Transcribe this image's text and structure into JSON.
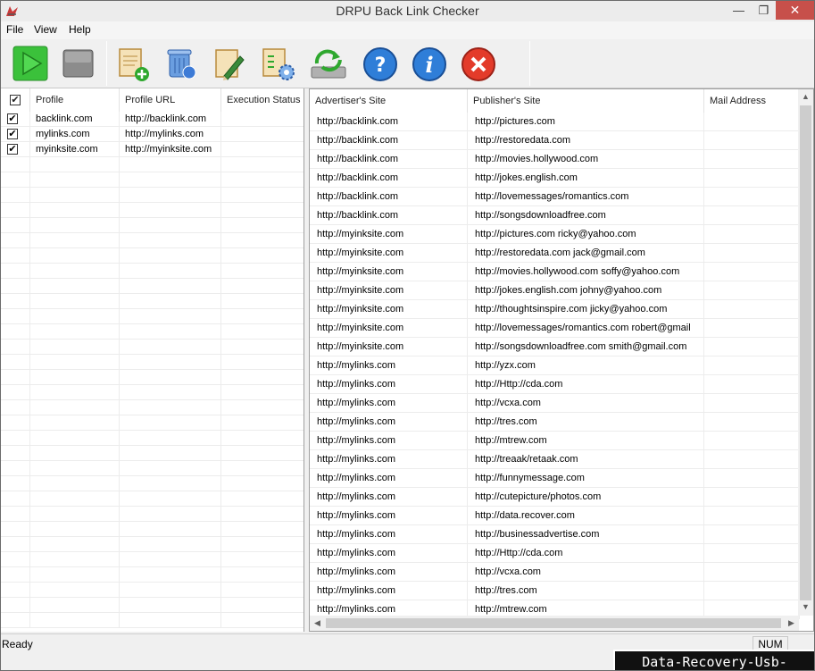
{
  "window": {
    "title": "DRPU Back Link Checker",
    "min_glyph": "—",
    "max_glyph": "❐",
    "close_glyph": "✕"
  },
  "menu": [
    "File",
    "View",
    "Help"
  ],
  "toolbar": {
    "buttons": [
      {
        "name": "start-icon",
        "color": "#3bc13b"
      },
      {
        "name": "stop-icon",
        "color": "#8c8c8c"
      },
      {
        "name": "add-profile-icon",
        "color": "#2fa82f"
      },
      {
        "name": "delete-profile-icon",
        "color": "#3d7bd6"
      },
      {
        "name": "edit-profile-icon",
        "color": "#3a8a3a"
      },
      {
        "name": "settings-icon",
        "color": "#3d7bd6"
      },
      {
        "name": "refresh-icon",
        "color": "#2fa82f"
      },
      {
        "name": "help-icon",
        "color": "#2f7ed8"
      },
      {
        "name": "about-icon",
        "color": "#2f7ed8"
      },
      {
        "name": "exit-icon",
        "color": "#e33b2a"
      }
    ]
  },
  "profiles": {
    "columns": [
      "✔",
      "Profile",
      "Profile URL",
      "Execution Status"
    ],
    "rows": [
      {
        "checked": "✔",
        "profile": "backlink.com",
        "url": "http://backlink.com",
        "status": ""
      },
      {
        "checked": "✔",
        "profile": "mylinks.com",
        "url": "http://mylinks.com",
        "status": ""
      },
      {
        "checked": "✔",
        "profile": "myinksite.com",
        "url": "http://myinksite.com",
        "status": ""
      }
    ]
  },
  "results": {
    "columns": [
      "Advertiser's Site",
      "Publisher's Site",
      "Mail Address"
    ],
    "rows": [
      [
        "http://backlink.com",
        "http://pictures.com",
        ""
      ],
      [
        "http://backlink.com",
        "http://restoredata.com",
        ""
      ],
      [
        "http://backlink.com",
        "http://movies.hollywood.com",
        ""
      ],
      [
        "http://backlink.com",
        "http://jokes.english.com",
        ""
      ],
      [
        "http://backlink.com",
        "http://lovemessages/romantics.com",
        ""
      ],
      [
        "http://backlink.com",
        "http://songsdownloadfree.com",
        ""
      ],
      [
        "http://myinksite.com",
        "http://pictures.com ricky@yahoo.com",
        ""
      ],
      [
        "http://myinksite.com",
        "http://restoredata.com jack@gmail.com",
        ""
      ],
      [
        "http://myinksite.com",
        "http://movies.hollywood.com soffy@yahoo.com",
        ""
      ],
      [
        "http://myinksite.com",
        "http://jokes.english.com johny@yahoo.com",
        ""
      ],
      [
        "http://myinksite.com",
        "http://thoughtsinspire.com jicky@yahoo.com",
        ""
      ],
      [
        "http://myinksite.com",
        "http://lovemessages/romantics.com robert@gmail",
        ""
      ],
      [
        "http://myinksite.com",
        "http://songsdownloadfree.com smith@gmail.com",
        ""
      ],
      [
        "http://mylinks.com",
        "http://yzx.com",
        ""
      ],
      [
        "http://mylinks.com",
        "http://Http://cda.com",
        ""
      ],
      [
        "http://mylinks.com",
        "http://vcxa.com",
        ""
      ],
      [
        "http://mylinks.com",
        "http://tres.com",
        ""
      ],
      [
        "http://mylinks.com",
        "http://mtrew.com",
        ""
      ],
      [
        "http://mylinks.com",
        "http://treaak/retaak.com",
        ""
      ],
      [
        "http://mylinks.com",
        "http://funnymessage.com",
        ""
      ],
      [
        "http://mylinks.com",
        "http://cutepicture/photos.com",
        ""
      ],
      [
        "http://mylinks.com",
        "http://data.recover.com",
        ""
      ],
      [
        "http://mylinks.com",
        "http://businessadvertise.com",
        ""
      ],
      [
        "http://mylinks.com",
        "http://Http://cda.com",
        ""
      ],
      [
        "http://mylinks.com",
        "http://vcxa.com",
        ""
      ],
      [
        "http://mylinks.com",
        "http://tres.com",
        ""
      ],
      [
        "http://mylinks.com",
        "http://mtrew.com",
        ""
      ]
    ]
  },
  "statusbar": {
    "text": "Ready",
    "num": "NUM"
  },
  "watermark": "Data-Recovery-Usb-Drive.com"
}
